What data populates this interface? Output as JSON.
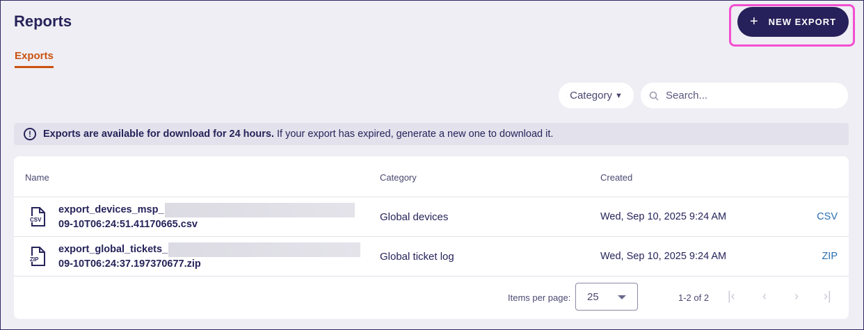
{
  "header": {
    "title": "Reports",
    "new_export_label": "NEW EXPORT"
  },
  "tabs": [
    {
      "label": "Exports",
      "active": true
    }
  ],
  "filters": {
    "category_label": "Category",
    "search_placeholder": "Search..."
  },
  "notice": {
    "bold": "Exports are available for download for 24 hours.",
    "text": " If your export has expired, generate a new one to download it."
  },
  "table": {
    "columns": [
      "Name",
      "Category",
      "Created"
    ],
    "rows": [
      {
        "name_line1": "export_devices_msp_",
        "name_line2": "09-10T06:24:51.41170665.csv",
        "file_type": "CSV",
        "category": "Global devices",
        "created": "Wed, Sep 10, 2025 9:24 AM",
        "download": "CSV"
      },
      {
        "name_line1": "export_global_tickets_",
        "name_line2": "09-10T06:24:37.197370677.zip",
        "file_type": "ZIP",
        "category": "Global ticket log",
        "created": "Wed, Sep 10, 2025 9:24 AM",
        "download": "ZIP"
      }
    ]
  },
  "pagination": {
    "items_per_page_label": "Items per page:",
    "items_per_page": "25",
    "range": "1-2 of 2"
  },
  "colors": {
    "primary": "#26215a",
    "accent": "#c9520f",
    "highlight": "#f24fd0",
    "link": "#2a6fb0"
  }
}
